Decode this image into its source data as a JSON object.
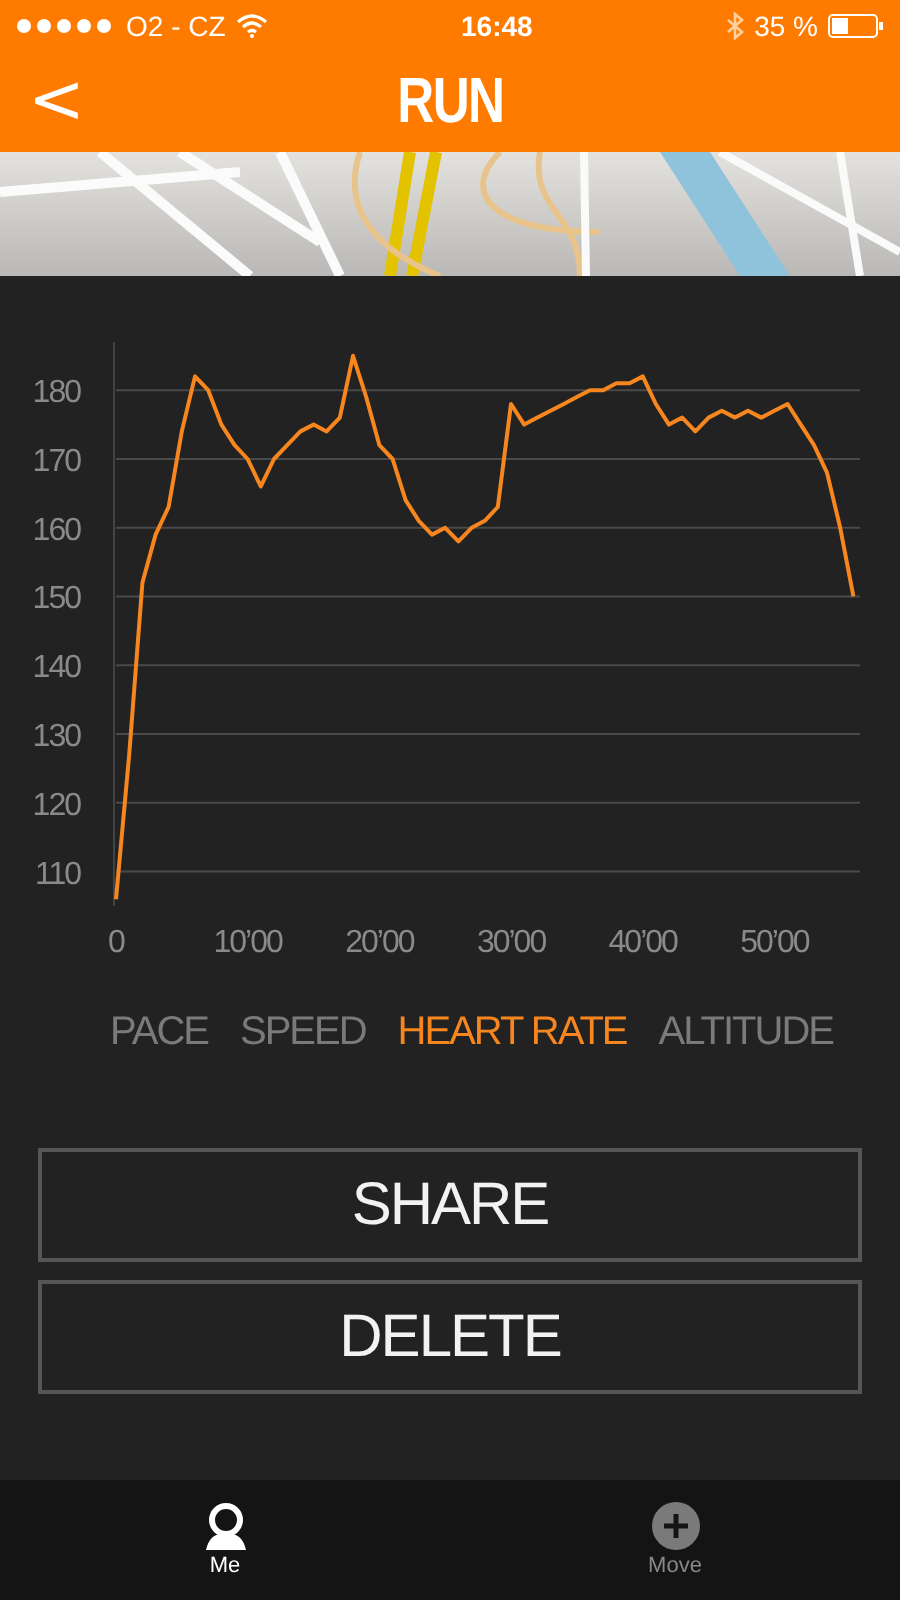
{
  "status_bar": {
    "carrier": "O2 - CZ",
    "time": "16:48",
    "battery": "35 %"
  },
  "nav": {
    "back": "<",
    "title": "RUN"
  },
  "chart_data": {
    "type": "line",
    "grid": true,
    "ylim": [
      105,
      187
    ],
    "yticks": [
      110,
      120,
      130,
      140,
      150,
      160,
      170,
      180
    ],
    "categories": [
      "0",
      null,
      null,
      null,
      null,
      null,
      null,
      null,
      null,
      null,
      "10’00",
      null,
      null,
      null,
      null,
      null,
      null,
      null,
      null,
      null,
      "20’00",
      null,
      null,
      null,
      null,
      null,
      null,
      null,
      null,
      null,
      "30’00",
      null,
      null,
      null,
      null,
      null,
      null,
      null,
      null,
      null,
      "40’00",
      null,
      null,
      null,
      null,
      null,
      null,
      null,
      null,
      null,
      "50’00",
      null,
      null,
      null,
      null,
      null,
      null
    ],
    "series": [
      {
        "color": "#f7861e",
        "values": [
          106,
          127,
          152,
          159,
          163,
          174,
          182,
          180,
          175,
          172,
          170,
          166,
          170,
          172,
          174,
          175,
          174,
          176,
          185,
          179,
          172,
          170,
          164,
          161,
          159,
          160,
          158,
          160,
          161,
          163,
          178,
          175,
          176,
          177,
          178,
          179,
          180,
          180,
          181,
          181,
          182,
          178,
          175,
          176,
          174,
          176,
          177,
          176,
          177,
          176,
          177,
          178,
          175,
          172,
          168,
          160,
          150
        ]
      }
    ]
  },
  "tabs": [
    {
      "label": "PACE",
      "selected": false
    },
    {
      "label": "SPEED",
      "selected": false
    },
    {
      "label": "HEART RATE",
      "selected": true
    },
    {
      "label": "ALTITUDE",
      "selected": false
    }
  ],
  "buttons": [
    "SHARE",
    "DELETE"
  ],
  "tab_bar": [
    {
      "label": "Me",
      "kind": "profile",
      "selected": true
    },
    {
      "label": "Move",
      "kind": "add",
      "selected": false
    }
  ]
}
